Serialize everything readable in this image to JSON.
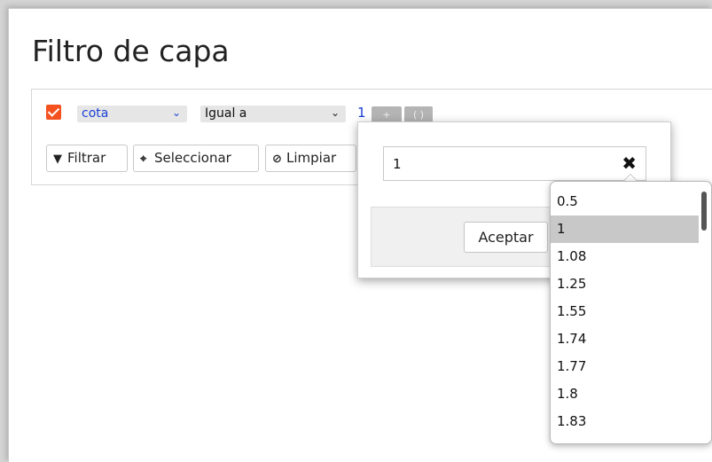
{
  "title": "Filtro de capa",
  "filter_row": {
    "checked": true,
    "field_select": "cota",
    "operator_select": "Igual a",
    "value": "1",
    "plus_label": "+",
    "paren_label": "( )"
  },
  "actions": {
    "filter_label": "Filtrar",
    "select_label": "Seleccionar",
    "clear_label": "Limpiar"
  },
  "popup": {
    "input_value": "1",
    "accept_label": "Aceptar"
  },
  "dropdown": {
    "items": [
      "0.5",
      "1",
      "1.08",
      "1.25",
      "1.55",
      "1.74",
      "1.77",
      "1.8",
      "1.83"
    ],
    "selected": "1"
  },
  "colors": {
    "accent": "#f4511e",
    "link": "#1a3fd6",
    "selected_bg": "#c8c8c8"
  }
}
